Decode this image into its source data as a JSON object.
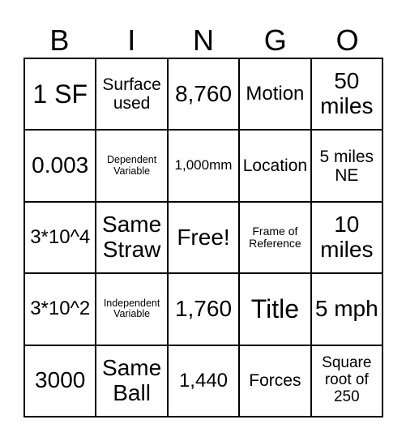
{
  "header": [
    "B",
    "I",
    "N",
    "G",
    "O"
  ],
  "cells": [
    [
      "1 SF",
      "Surface used",
      "8,760",
      "Motion",
      "50 miles"
    ],
    [
      "0.003",
      "Dependent Variable",
      "1,000mm",
      "Location",
      "5 miles NE"
    ],
    [
      "3*10^4",
      "Same Straw",
      "Free!",
      "Frame of Reference",
      "10 miles"
    ],
    [
      "3*10^2",
      "Independent Variable",
      "1,760",
      "Title",
      "5 mph"
    ],
    [
      "3000",
      "Same Ball",
      "1,440",
      "Forces",
      "Square root of 250"
    ]
  ]
}
